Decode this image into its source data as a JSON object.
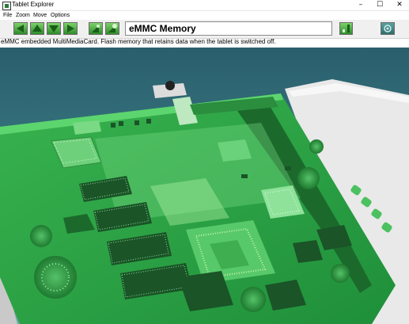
{
  "window": {
    "title": "Tablet Explorer",
    "minimize": "–",
    "maximize": "☐",
    "close": "✕"
  },
  "menu": [
    "File",
    "Zoom",
    "Move",
    "Options"
  ],
  "toolbar": {
    "buttons": [
      "arrow-left-icon",
      "arrow-up-icon",
      "arrow-down-icon",
      "arrow-right-icon",
      "zoom-out-icon",
      "zoom-in-icon",
      "bookmark-icon",
      "view-icon"
    ],
    "component_title": "eMMC Memory"
  },
  "description": "eMMC embedded MultiMediaCard. Flash memory that retains data when the tablet is switched off.",
  "colors": {
    "board": "#2fa84a",
    "board_dark": "#1d7a33",
    "button_green": "#3fa53b"
  }
}
